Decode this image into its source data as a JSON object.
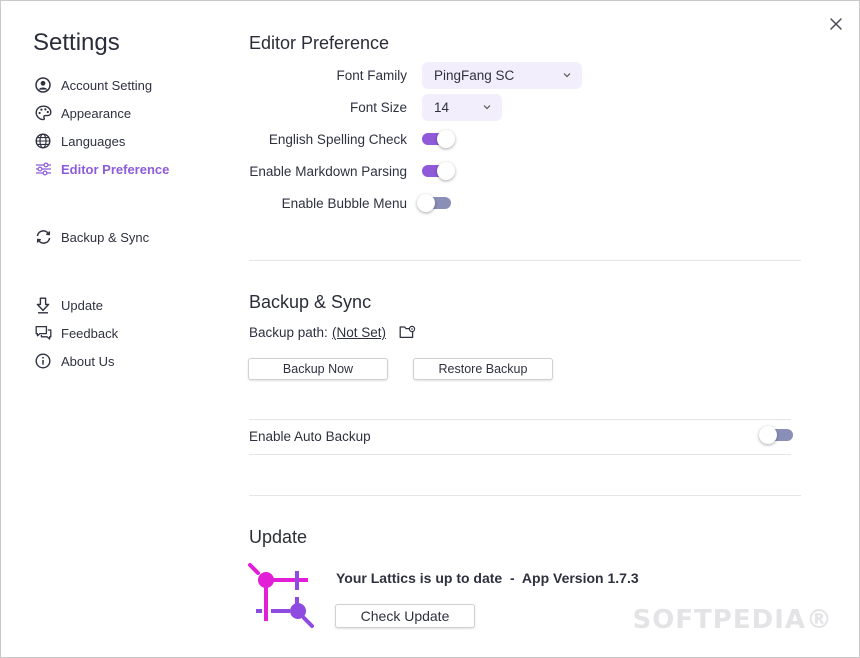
{
  "window": {
    "close_label": "×"
  },
  "sidebar": {
    "title": "Settings",
    "items": [
      {
        "label": "Account Setting",
        "icon": "user-circle-icon",
        "active": false
      },
      {
        "label": "Appearance",
        "icon": "palette-icon",
        "active": false
      },
      {
        "label": "Languages",
        "icon": "globe-icon",
        "active": false
      },
      {
        "label": "Editor Preference",
        "icon": "sliders-icon",
        "active": true
      },
      {
        "label": "Backup & Sync",
        "icon": "sync-icon",
        "active": false
      },
      {
        "label": "Update",
        "icon": "download-arrow-icon",
        "active": false
      },
      {
        "label": "Feedback",
        "icon": "chat-bubbles-icon",
        "active": false
      },
      {
        "label": "About Us",
        "icon": "info-icon",
        "active": false
      }
    ]
  },
  "editor": {
    "title": "Editor Preference",
    "font_family_label": "Font Family",
    "font_family_value": "PingFang SC",
    "font_size_label": "Font Size",
    "font_size_value": "14",
    "spelling_label": "English Spelling Check",
    "spelling_on": true,
    "markdown_label": "Enable Markdown Parsing",
    "markdown_on": true,
    "bubble_label": "Enable Bubble Menu",
    "bubble_on": false
  },
  "backup": {
    "title": "Backup & Sync",
    "path_label": "Backup path:",
    "path_value": "(Not Set)",
    "backup_now_label": "Backup Now",
    "restore_label": "Restore Backup",
    "auto_label": "Enable Auto Backup",
    "auto_on": false
  },
  "update": {
    "title": "Update",
    "status": "Your Lattics is up to date  -  App Version 1.7.3",
    "check_label": "Check Update"
  },
  "watermark": "SOFTPEDIA®",
  "colors": {
    "accent": "#8d5cd9",
    "toggle_off": "#8a8fb8",
    "select_bg": "#f3eefb",
    "logo_magenta": "#e21fd6",
    "logo_purple": "#8e4be0"
  }
}
